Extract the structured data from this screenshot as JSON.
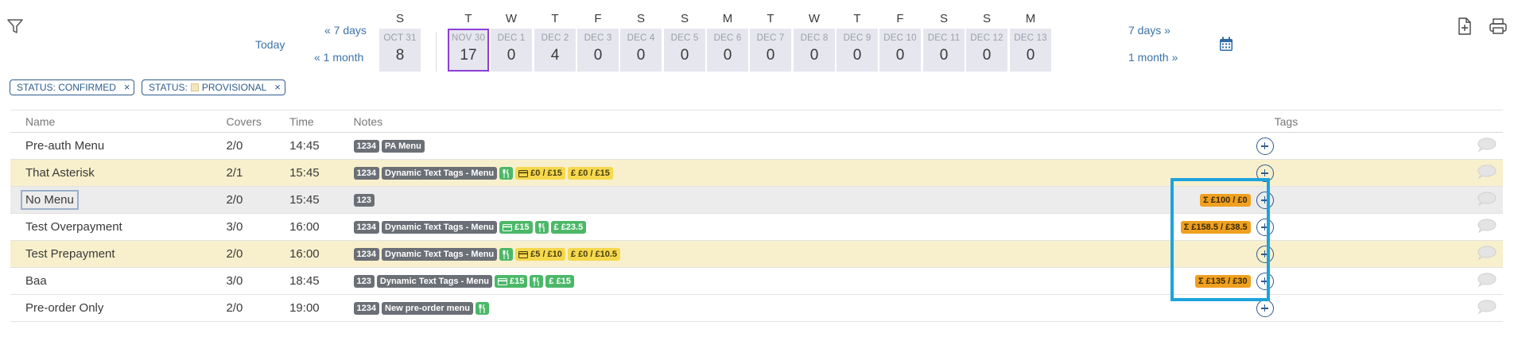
{
  "toolbar": {
    "filter_icon": "filter-icon",
    "add_doc_icon": "add-document-icon",
    "print_icon": "printer-icon"
  },
  "navigation": {
    "today": "Today",
    "back_7": "« 7 days",
    "back_month": "« 1 month",
    "fwd_7": "7 days »",
    "fwd_month": "1 month »",
    "calendar_icon": "calendar-icon"
  },
  "dates": [
    {
      "dow": "S",
      "date": "OCT 31",
      "count": "8"
    },
    {
      "dow": "T",
      "date": "NOV 30",
      "count": "17",
      "selected": true
    },
    {
      "dow": "W",
      "date": "DEC 1",
      "count": "0"
    },
    {
      "dow": "T",
      "date": "DEC 2",
      "count": "4"
    },
    {
      "dow": "F",
      "date": "DEC 3",
      "count": "0"
    },
    {
      "dow": "S",
      "date": "DEC 4",
      "count": "0"
    },
    {
      "dow": "S",
      "date": "DEC 5",
      "count": "0"
    },
    {
      "dow": "M",
      "date": "DEC 6",
      "count": "0"
    },
    {
      "dow": "T",
      "date": "DEC 7",
      "count": "0"
    },
    {
      "dow": "W",
      "date": "DEC 8",
      "count": "0"
    },
    {
      "dow": "T",
      "date": "DEC 9",
      "count": "0"
    },
    {
      "dow": "F",
      "date": "DEC 10",
      "count": "0"
    },
    {
      "dow": "S",
      "date": "DEC 11",
      "count": "0"
    },
    {
      "dow": "S",
      "date": "DEC 12",
      "count": "0"
    },
    {
      "dow": "M",
      "date": "DEC 13",
      "count": "0"
    }
  ],
  "filters": [
    {
      "label": "STATUS: CONFIRMED",
      "remove": "×"
    },
    {
      "prefix": "STATUS:",
      "label": "PROVISIONAL",
      "remove": "×"
    }
  ],
  "table": {
    "headers": {
      "name": "Name",
      "covers": "Covers",
      "time": "Time",
      "notes": "Notes",
      "tags": "Tags"
    },
    "rows": [
      {
        "name": "Pre-auth Menu",
        "covers": "2/0",
        "time": "14:45",
        "style": "",
        "tags": [
          {
            "kind": "dark",
            "text": "1234"
          },
          {
            "kind": "dark",
            "text": "PA Menu"
          }
        ],
        "sum": ""
      },
      {
        "name": "That Asterisk",
        "covers": "2/1",
        "time": "15:45",
        "style": "yellow",
        "tags": [
          {
            "kind": "dark",
            "text": "1234"
          },
          {
            "kind": "dark",
            "text": "Dynamic Text Tags - Menu"
          },
          {
            "kind": "green",
            "icon": "cutlery-icon",
            "text": ""
          },
          {
            "kind": "yellow",
            "icon": "card-icon",
            "text": "£0 / £15"
          },
          {
            "kind": "yellow",
            "text": "£  £0 / £15"
          }
        ],
        "sum": ""
      },
      {
        "name": "No Menu",
        "covers": "2/0",
        "time": "15:45",
        "style": "grey",
        "boxed": true,
        "tags": [
          {
            "kind": "dark",
            "text": "123"
          }
        ],
        "sum": "£100 / £0"
      },
      {
        "name": "Test Overpayment",
        "covers": "3/0",
        "time": "16:00",
        "style": "",
        "tags": [
          {
            "kind": "dark",
            "text": "1234"
          },
          {
            "kind": "dark",
            "text": "Dynamic Text Tags - Menu"
          },
          {
            "kind": "green",
            "icon": "card-icon",
            "text": "£15"
          },
          {
            "kind": "green",
            "icon": "cutlery-icon",
            "text": ""
          },
          {
            "kind": "green",
            "text": "£  £23.5"
          }
        ],
        "sum": "£158.5 / £38.5"
      },
      {
        "name": "Test Prepayment",
        "covers": "2/0",
        "time": "16:00",
        "style": "yellow",
        "tags": [
          {
            "kind": "dark",
            "text": "1234"
          },
          {
            "kind": "dark",
            "text": "Dynamic Text Tags - Menu"
          },
          {
            "kind": "green",
            "icon": "cutlery-icon",
            "text": ""
          },
          {
            "kind": "yellow",
            "icon": "card-icon",
            "text": "£5 / £10"
          },
          {
            "kind": "yellow",
            "text": "£  £0 / £10.5"
          }
        ],
        "sum": ""
      },
      {
        "name": "Baa",
        "covers": "3/0",
        "time": "18:45",
        "style": "",
        "tags": [
          {
            "kind": "dark",
            "text": "123"
          },
          {
            "kind": "dark",
            "text": "Dynamic Text Tags - Menu"
          },
          {
            "kind": "green",
            "icon": "card-icon",
            "text": "£15"
          },
          {
            "kind": "green",
            "icon": "cutlery-icon",
            "text": ""
          },
          {
            "kind": "green",
            "text": "£  £15"
          }
        ],
        "sum": "£135 / £30"
      },
      {
        "name": "Pre-order Only",
        "covers": "2/0",
        "time": "19:00",
        "style": "",
        "tags": [
          {
            "kind": "dark",
            "text": "1234"
          },
          {
            "kind": "dark",
            "text": "New pre-order menu"
          },
          {
            "kind": "green",
            "icon": "cutlery-icon",
            "text": ""
          }
        ],
        "sum": ""
      }
    ]
  },
  "colors": {
    "accent": "#2e5c8f",
    "selected_border": "#8e3fd6",
    "highlight": "#1ea3dc",
    "row_yellow": "#f8f0cc"
  }
}
